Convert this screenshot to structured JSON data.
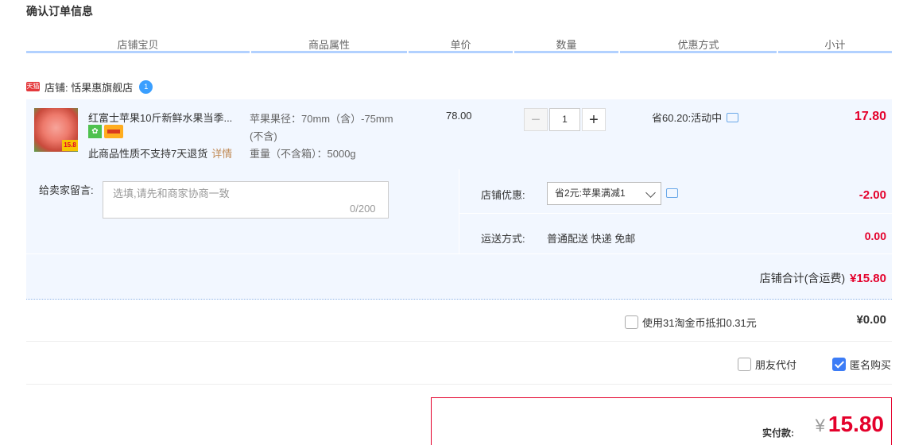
{
  "page": {
    "title": "确认订单信息"
  },
  "table_headers": [
    "店铺宝贝",
    "商品属性",
    "单价",
    "数量",
    "优惠方式",
    "小计"
  ],
  "shop": {
    "badge": "天猫",
    "label": "店铺: 恬果惠旗舰店",
    "ww_badge": "1"
  },
  "item": {
    "title": "红富士苹果10斤新鲜水果当季...",
    "image_badge": "15.8",
    "return_note": "此商品性质不支持7天退货",
    "return_link": "详情",
    "props": [
      "苹果果径：70mm（含）-75mm",
      "(不含)",
      "重量（不含箱）：5000g"
    ],
    "price": "78.00",
    "quantity": "1",
    "qty_minus": "−",
    "qty_plus": "+",
    "promo": "省60.20:活动中",
    "subtotal": "17.80"
  },
  "message": {
    "label": "给卖家留言:",
    "placeholder": "选填,请先和商家协商一致",
    "count": "0/200"
  },
  "shop_discount": {
    "label": "店铺优惠:",
    "selected": "省2元:苹果满减1",
    "amount": "-2.00"
  },
  "shipping": {
    "label": "运送方式:",
    "value": "普通配送 快递 免邮",
    "amount": "0.00"
  },
  "shop_total": {
    "label": "店铺合计(含运费)",
    "amount": "¥15.80"
  },
  "coins": {
    "label": "使用31淘金币抵扣0.31元",
    "amount": "¥0.00",
    "checked": false
  },
  "friend_pay": {
    "label": "朋友代付",
    "checked": false
  },
  "anonymous": {
    "label": "匿名购买",
    "checked": true
  },
  "payment": {
    "label": "实付款:",
    "currency": "¥",
    "amount": "15.80"
  },
  "colors": {
    "accent_red": "#e4002b",
    "header_line": "#b2d1ff",
    "row_bg": "#f2f7ff",
    "checkbox_blue": "#3c7cf6"
  }
}
